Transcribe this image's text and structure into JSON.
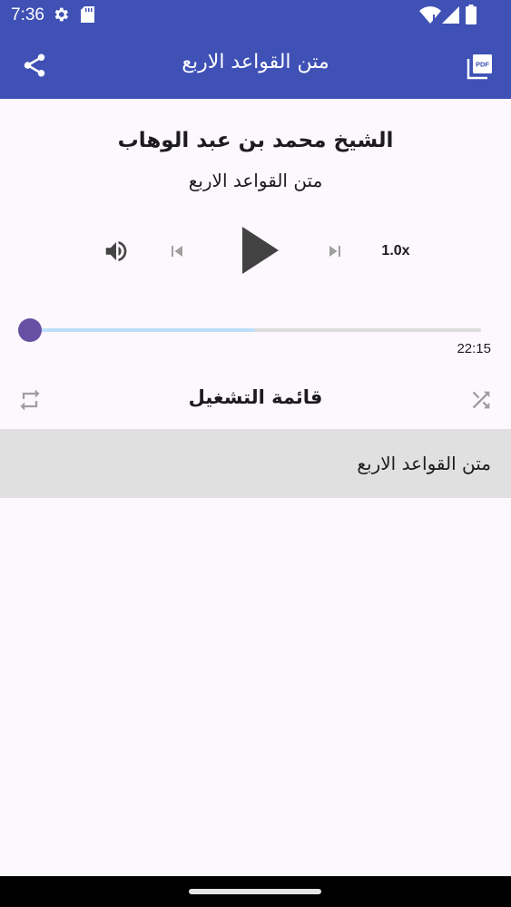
{
  "status_bar": {
    "time": "7:36",
    "icons": [
      "settings-icon",
      "sd-card-icon",
      "wifi-icon",
      "signal-icon",
      "battery-icon"
    ]
  },
  "app_bar": {
    "title": "متن القواعد الاربع",
    "left_icon": "share-icon",
    "right_icon": "pdf-icon",
    "color": "#3f51b5"
  },
  "player": {
    "author": "الشيخ محمد بن عبد الوهاب",
    "track_title": "متن القواعد الاربع",
    "speed": "1.0x",
    "duration": "22:15",
    "progress": 0,
    "buffered": 0.5,
    "accent_color": "#6750a4",
    "buffer_color": "#bbdefb"
  },
  "playlist": {
    "title": "قائمة التشغيل",
    "items": [
      {
        "label": "متن القواعد الاربع"
      }
    ]
  }
}
